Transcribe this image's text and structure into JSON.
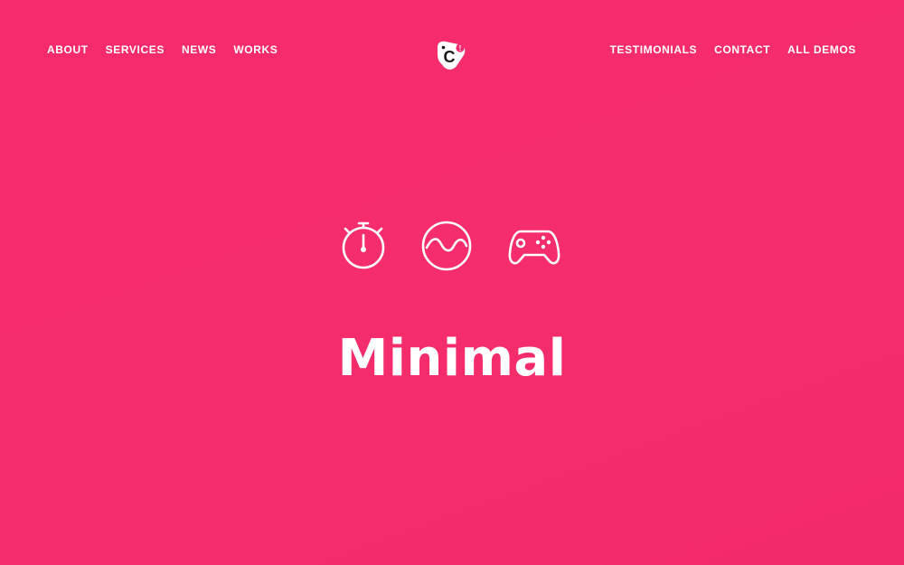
{
  "nav": {
    "left": [
      "ABOUT",
      "SERVICES",
      "NEWS",
      "WORKS"
    ],
    "right": [
      "TESTIMONIALS",
      "CONTACT",
      "ALL DEMOS"
    ]
  },
  "logo": {
    "letter": "C",
    "badge": "!"
  },
  "hero": {
    "icons": [
      "stopwatch-icon",
      "wave-icon",
      "gamepad-icon"
    ],
    "title": "Minimal"
  },
  "colors": {
    "background": "#f52d6c",
    "text": "#ffffff",
    "logo_badge": "#f72a6b"
  }
}
